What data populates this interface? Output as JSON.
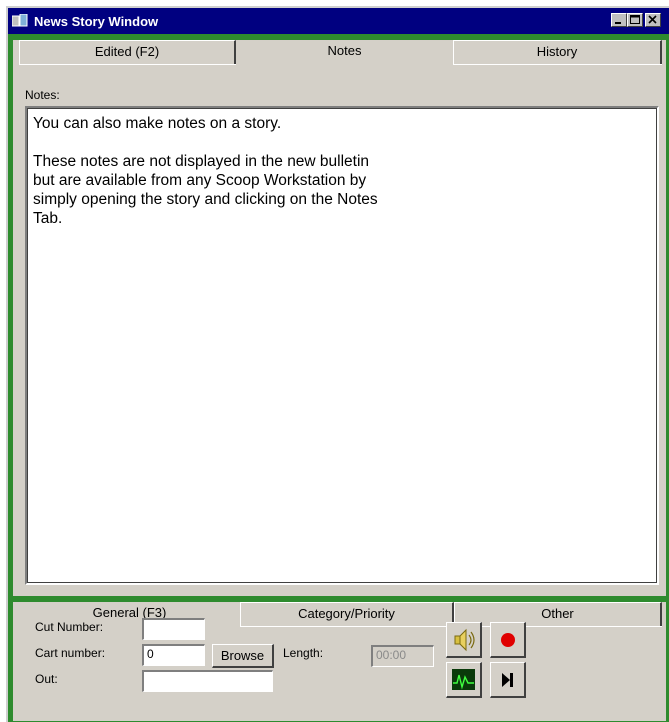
{
  "window": {
    "title": "News Story Window"
  },
  "top_tabs": [
    {
      "label": "Edited (F2)",
      "active": false
    },
    {
      "label": "Notes",
      "active": true
    },
    {
      "label": "History",
      "active": false
    }
  ],
  "notes": {
    "label": "Notes:",
    "text": "You can also make notes on a story.\n\nThese notes are not displayed in the new bulletin\nbut are available from any Scoop Workstation by\nsimply opening the story and clicking on the Notes\nTab."
  },
  "bottom_tabs": [
    {
      "label": "General (F3)",
      "active": true
    },
    {
      "label": "Category/Priority",
      "active": false
    },
    {
      "label": "Other",
      "active": false
    }
  ],
  "general": {
    "cut_number_label": "Cut Number:",
    "cut_number_value": "",
    "cart_number_label": "Cart number:",
    "cart_number_value": "0",
    "browse_label": "Browse",
    "length_label": "Length:",
    "length_value": "00:00",
    "out_label": "Out:",
    "out_value": ""
  },
  "colors": {
    "window_frame": "#2e8b2e",
    "titlebar": "#000080",
    "record": "#e00000"
  },
  "icons": [
    "window-icon",
    "minimize-icon",
    "maximize-icon",
    "close-icon",
    "speaker-icon",
    "record-icon",
    "waveform-icon",
    "play-to-end-icon"
  ]
}
